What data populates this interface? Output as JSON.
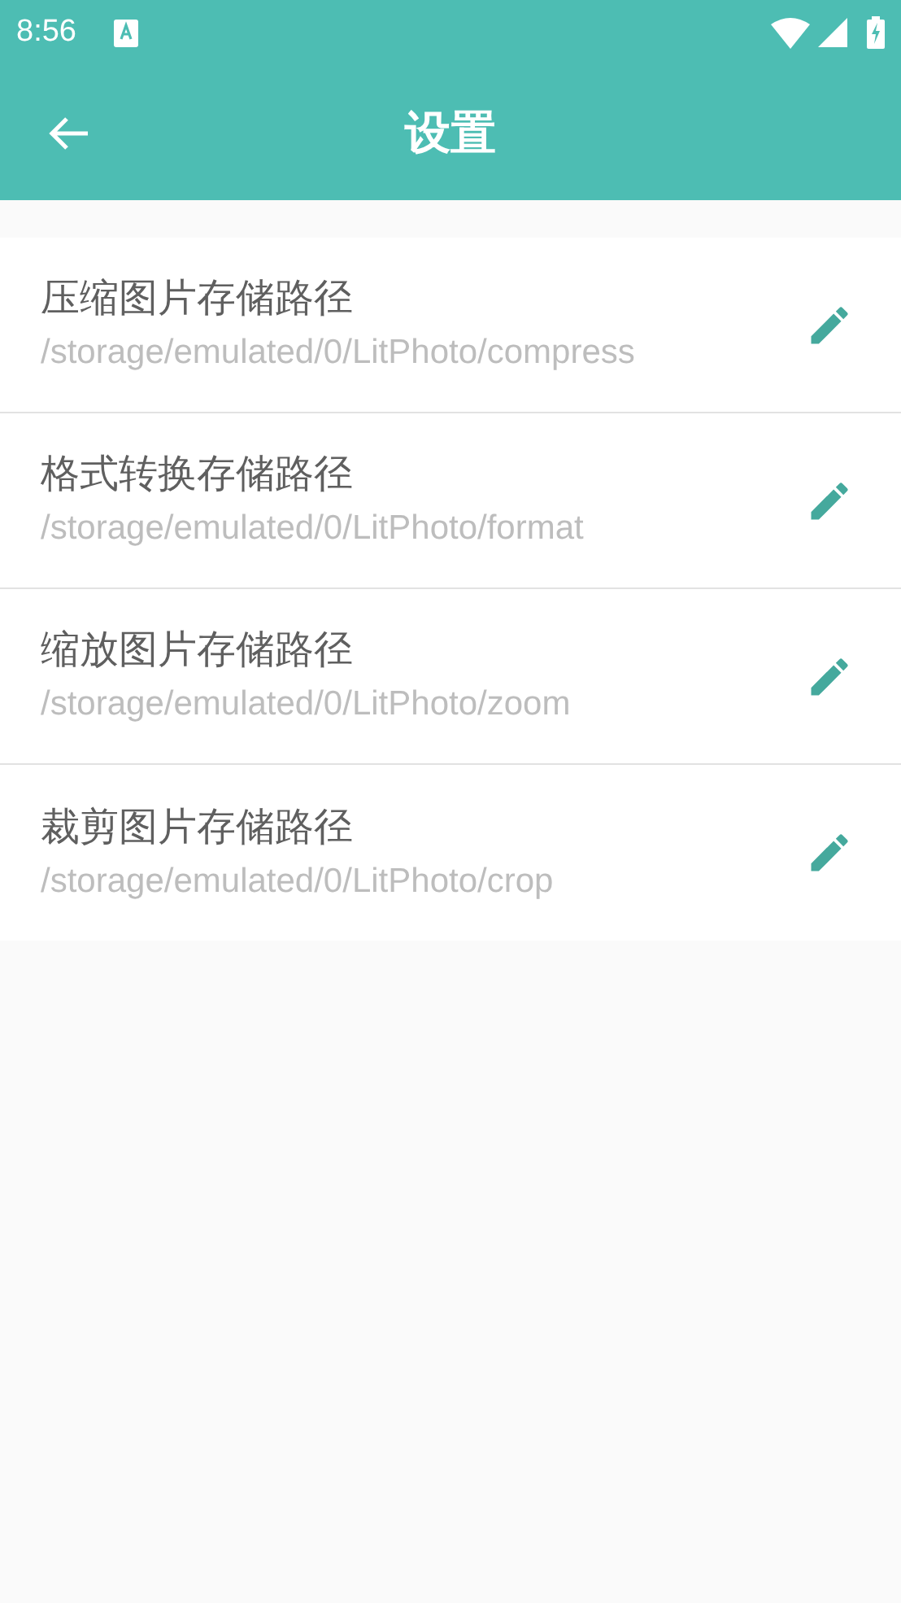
{
  "status_bar": {
    "time": "8:56"
  },
  "toolbar": {
    "title": "设置"
  },
  "settings": [
    {
      "title": "压缩图片存储路径",
      "path": "/storage/emulated/0/LitPhoto/compress"
    },
    {
      "title": "格式转换存储路径",
      "path": "/storage/emulated/0/LitPhoto/format"
    },
    {
      "title": "缩放图片存储路径",
      "path": "/storage/emulated/0/LitPhoto/zoom"
    },
    {
      "title": "裁剪图片存储路径",
      "path": "/storage/emulated/0/LitPhoto/crop"
    }
  ]
}
